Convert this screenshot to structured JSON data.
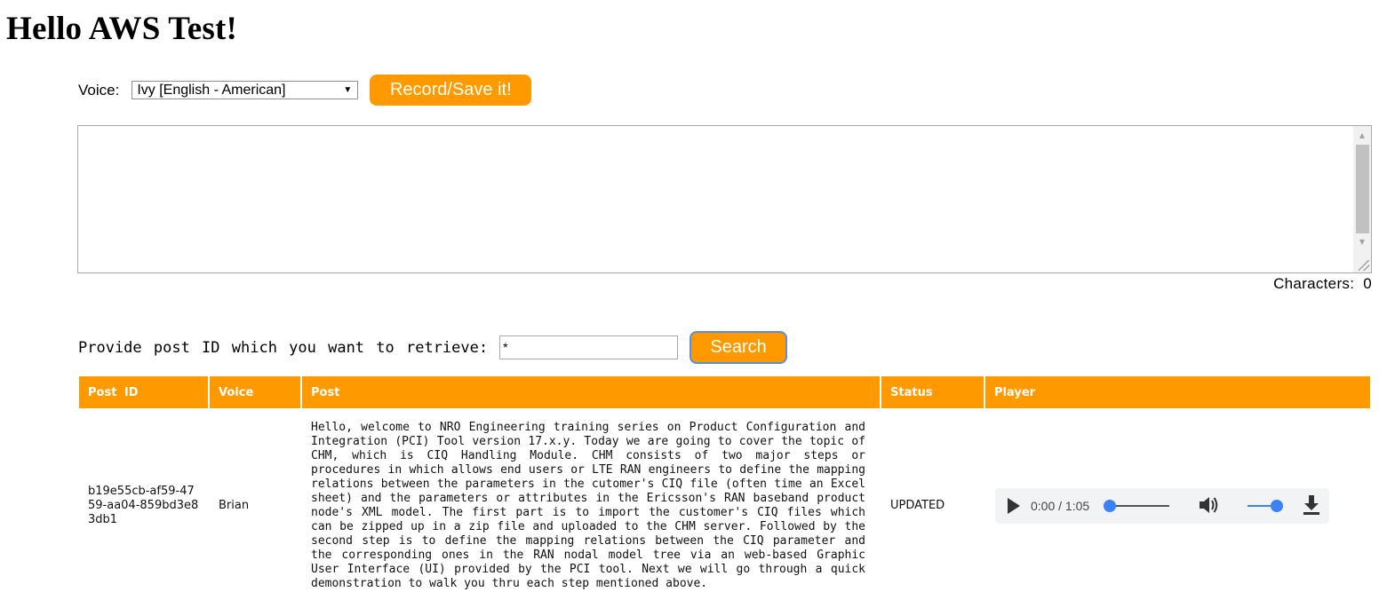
{
  "page": {
    "title": "Hello AWS Test!"
  },
  "voice": {
    "label": "Voice:",
    "selected": "Ivy [English - American]",
    "record_button": "Record/Save it!"
  },
  "editor": {
    "value": "",
    "characters_label": "Characters:",
    "characters_count": "0"
  },
  "search": {
    "label": "Provide post ID which you want to retrieve:",
    "value": "*",
    "button": "Search"
  },
  "table": {
    "headers": [
      "Post ID",
      "Voice",
      "Post",
      "Status",
      "Player"
    ],
    "rows": [
      {
        "post_id": "b19e55cb-af59-4759-aa04-859bd3e83db1",
        "voice": "Brian",
        "post": "Hello, welcome to NRO Engineering training series on Product Configuration and Integration (PCI) Tool version 17.x.y. Today we are going to cover the topic of CHM, which is CIQ Handling Module. CHM consists of two major steps or procedures in which allows end users or LTE RAN engineers to define the mapping relations between the parameters in the cutomer's CIQ file (often time an Excel sheet) and the parameters or attributes in the Ericsson's RAN baseband product node's XML model. The first part is to import the customer's CIQ files which can be zipped up in a zip file and uploaded to the CHM server. Followed by the second step is to define the mapping relations between the CIQ parameter and the corresponding ones in the RAN nodal model tree via an web-based Graphic User Interface (UI) provided by the PCI tool. Next we will go through a quick demonstration to walk you thru each step mentioned above.",
        "status": "UPDATED",
        "player": {
          "time": "0:00 / 1:05",
          "progress": 0,
          "volume": 1
        }
      }
    ]
  },
  "colors": {
    "accent": "#ff9900",
    "slider": "#3b82f6"
  },
  "icons": {
    "play": "play-icon",
    "volume": "volume-icon",
    "download": "download-icon"
  }
}
